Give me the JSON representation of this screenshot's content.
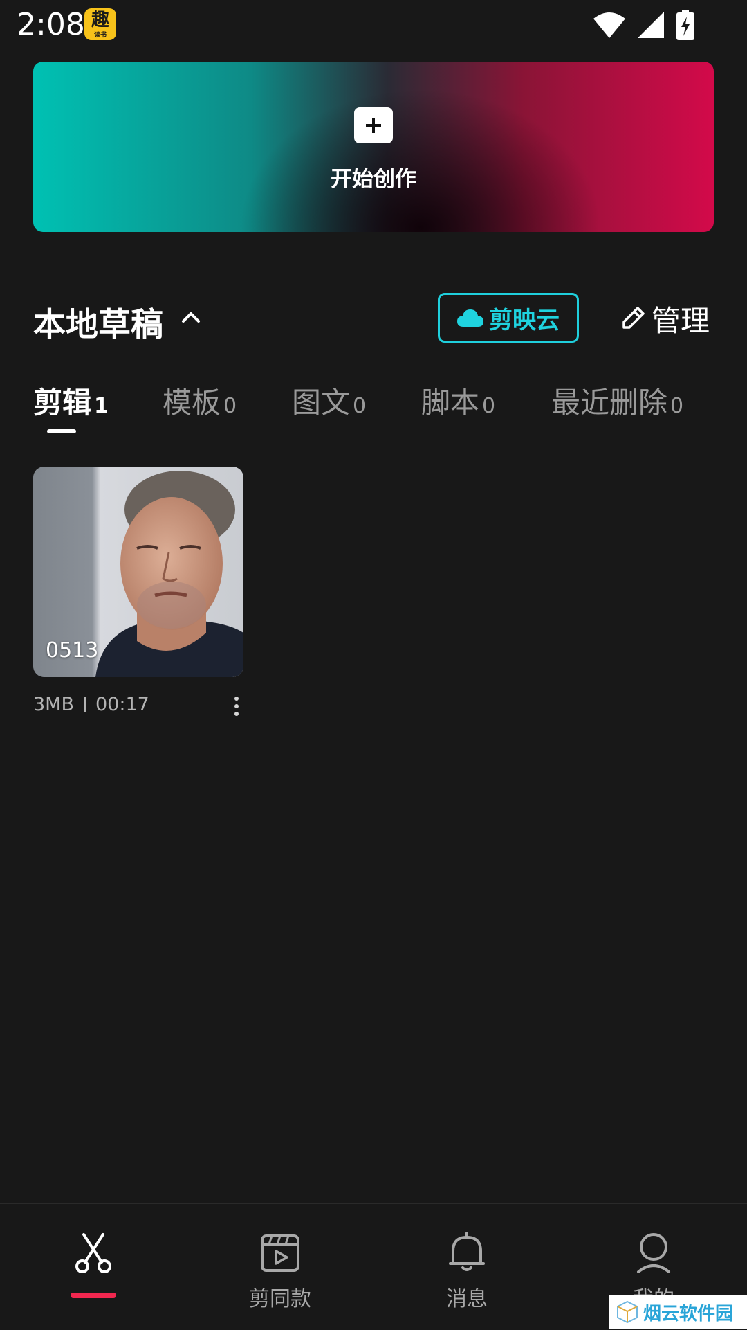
{
  "status_bar": {
    "time": "2:08",
    "app_icon_text": "趣",
    "app_icon_subtext": "读书"
  },
  "create": {
    "label": "开始创作"
  },
  "section": {
    "title": "本地草稿",
    "cloud_label": "剪映云",
    "manage_label": "管理"
  },
  "tabs": [
    {
      "label": "剪辑",
      "count": "1"
    },
    {
      "label": "模板",
      "count": "0"
    },
    {
      "label": "图文",
      "count": "0"
    },
    {
      "label": "脚本",
      "count": "0"
    },
    {
      "label": "最近删除",
      "count": "0"
    }
  ],
  "drafts": [
    {
      "name": "0513",
      "size": "3MB",
      "duration": "00:17"
    }
  ],
  "nav": [
    {
      "icon": "scissors-icon",
      "label": ""
    },
    {
      "icon": "clapperboard-icon",
      "label": "剪同款"
    },
    {
      "icon": "bell-icon",
      "label": "消息"
    },
    {
      "icon": "user-icon",
      "label": "我的"
    }
  ],
  "watermark": {
    "text": "烟云软件园"
  },
  "colors": {
    "accent_cyan": "#1fcfdc",
    "accent_red": "#f1274f",
    "background": "#181818"
  }
}
